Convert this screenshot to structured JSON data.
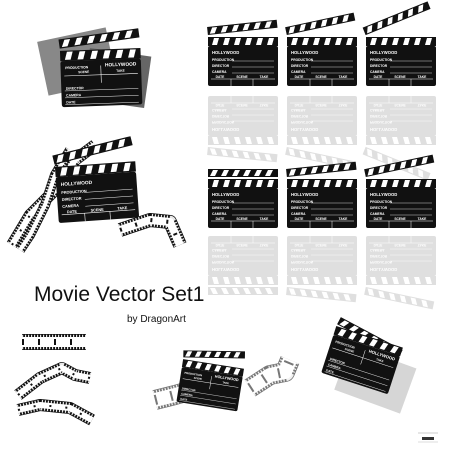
{
  "title": "Movie Vector Set1",
  "byline": "by DragonArt",
  "clapperboard": {
    "brand": "HOLLYWOOD",
    "fields": [
      "PRODUCTION",
      "DIRECTOR",
      "CAMERA"
    ],
    "columns": [
      "DATE",
      "SCENE",
      "TAKE"
    ],
    "alt_fields": [
      "PRODUCTION",
      "SCENE",
      "TAKE",
      "DIRECTOR",
      "CAMERA",
      "DATE"
    ]
  },
  "colors": {
    "board": "#111111",
    "film_gray": "#777777",
    "shadow": "#cfcfcf"
  }
}
